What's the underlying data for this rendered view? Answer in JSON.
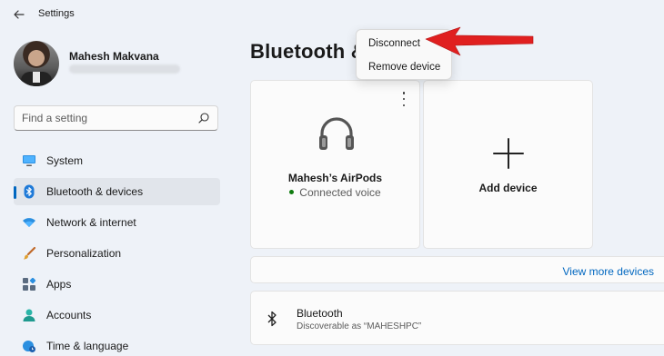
{
  "window": {
    "title": "Settings"
  },
  "user": {
    "name": "Mahesh Makvana",
    "email": ""
  },
  "search": {
    "placeholder": "Find a setting"
  },
  "sidebar": {
    "items": [
      {
        "label": "System",
        "icon": "monitor-icon",
        "active": false
      },
      {
        "label": "Bluetooth & devices",
        "icon": "bluetooth-icon",
        "active": true
      },
      {
        "label": "Network & internet",
        "icon": "wifi-icon",
        "active": false
      },
      {
        "label": "Personalization",
        "icon": "paintbrush-icon",
        "active": false
      },
      {
        "label": "Apps",
        "icon": "apps-icon",
        "active": false
      },
      {
        "label": "Accounts",
        "icon": "person-icon",
        "active": false
      },
      {
        "label": "Time & language",
        "icon": "globe-clock-icon",
        "active": false
      }
    ]
  },
  "main": {
    "title": "Bluetooth &",
    "device_card": {
      "name": "Mahesh’s AirPods",
      "status": "Connected voice"
    },
    "add_card": {
      "label": "Add device"
    },
    "view_more": {
      "label": "View more devices"
    },
    "bluetooth_row": {
      "title": "Bluetooth",
      "subtitle": "Discoverable as “MAHESHPC”"
    }
  },
  "context_menu": {
    "items": [
      {
        "label": "Disconnect"
      },
      {
        "label": "Remove device"
      }
    ]
  },
  "colors": {
    "accent": "#0067c0",
    "annotation_arrow": "#e02020",
    "connected_dot": "#0f7b0f"
  }
}
